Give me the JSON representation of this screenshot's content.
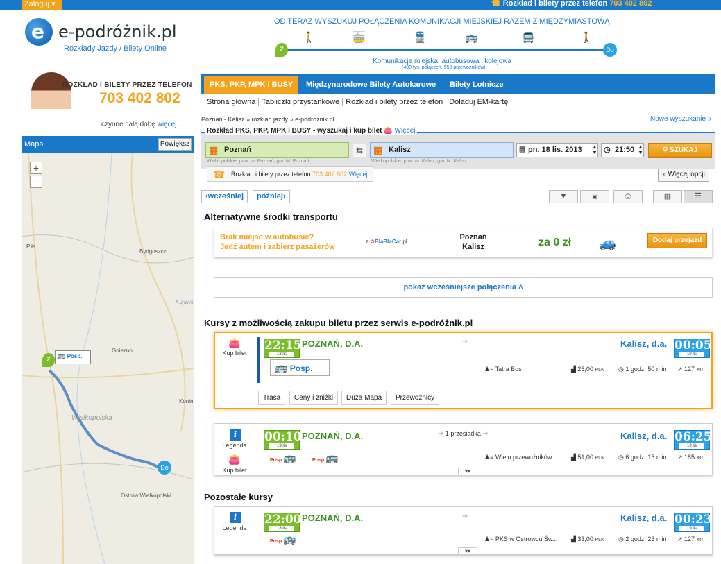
{
  "topbar": {
    "login": "Zaloguj",
    "phone_text": "Rozkład i bilety przez telefon",
    "phone_number": "703 402 802"
  },
  "logo": {
    "name": "e-podróżnik.pl",
    "subtitle": "Rozkłady Jazdy / Bilety Online"
  },
  "banner": {
    "title": "OD TERAZ WYSZUKUJ POŁĄCZENIA KOMUNIKACJI MIEJSKIEJ RAZEM Z MIĘDZYMIASTOWĄ",
    "z": "Z",
    "do": "Do",
    "sub1": "Komunikacja miejska, autobusowa i kolejowa",
    "sub2": "(400 tys. połączeń, 550 przewoźników)"
  },
  "phonebox": {
    "title": "ROZKŁAD I BILETY PRZEZ TELEFON",
    "number": "703 402 802",
    "hours": "czynne całą dobę",
    "more": "więcej..."
  },
  "map": {
    "title": "Mapa",
    "enlarge": "Powiększ",
    "zoom_in": "+",
    "zoom_out": "−",
    "labels": {
      "pila": "Piła",
      "bydgoszcz": "Bydgoszcz",
      "kujawy": "Kujaws",
      "gniezno": "Gniezno",
      "konin": "Konin",
      "wlkp": "Wielkopolska",
      "ostrow": "Ostrów Wielkopolski"
    },
    "marker_z": "Z",
    "marker_do": "Do",
    "posp": "Posp."
  },
  "tabs": [
    "PKS, PKP, MPK i BUSY",
    "Międzynarodowe Bilety Autokarowe",
    "Bilety Lotnicze"
  ],
  "subnav": [
    "Strona główna",
    "Tabliczki przystankowe",
    "Rozkład i bilety przez telefon",
    "Doładuj EM-kartę"
  ],
  "breadcrumb": "Poznań - Kalisz » rozkład jazdy » e-podroznik.pl",
  "new_search": "Nowe wyszukanie »",
  "search": {
    "legend": "Rozkład PKS, PKP, MPK i BUSY - wyszukaj i kup bilet",
    "legend_more": "Więcej",
    "from": "Poznań",
    "from_hint": "Wielkopolskie, pow. m. Poznań, gm. M. Poznań",
    "to": "Kalisz",
    "to_hint": "Wielkopolskie, pow. m. Kalisz, gm. M. Kalisz",
    "date": "pn. 18 lis. 2013",
    "time": "21:50",
    "button": "SZUKAJ",
    "more_options": "Więcej opcji",
    "phone_strip": "Rozkład i bilety przez telefon",
    "phone_number": "703 402 802",
    "phone_more": "Więcej"
  },
  "nav": {
    "earlier": "wcześniej",
    "later": "później"
  },
  "alt_transport": {
    "title": "Alternatywne środki transportu",
    "line1": "Brak miejsc w autobusie?",
    "line2": "Jedź autem i zabierz pasażerów",
    "logo_prefix": "z",
    "logo": "BlaBlaCar",
    "logo_suffix": ".pl",
    "route_from": "Poznań",
    "route_to": "Kalisz",
    "price": "za 0 zł",
    "button": "Dodaj przejazd"
  },
  "show_earlier": "pokaż wcześniejsze połączenia",
  "section_buy": "Kursy z możliwością zakupu biletu przez serwis e-podróżnik.pl",
  "section_other": "Pozostałe kursy",
  "routes": [
    {
      "buy_label": "Kup bilet",
      "dep_time": "22:15",
      "dep_date": "18 lis",
      "from": "POZNAŃ, D.A.",
      "posp": "Posp.",
      "to": "Kalisz, d.a.",
      "arr_time": "00:05",
      "arr_date": "19 lis",
      "carrier": "Tatra Bus",
      "price": "25,00",
      "currency": "PLN",
      "duration": "1 godz. 50 min",
      "distance": "127 km",
      "tabs": [
        "Trasa",
        "Ceny i zniżki",
        "Duża Mapa",
        "Przewoźnicy"
      ]
    },
    {
      "legend": "Legenda",
      "buy_label": "Kup bilet",
      "dep_time": "00:10",
      "dep_date": "19 lis",
      "from": "POZNAŃ, D.A.",
      "transfer": "1 przesiadka",
      "posp": "Posp.",
      "to": "Kalisz, d.a.",
      "arr_time": "06:25",
      "arr_date": "19 lis",
      "carrier": "Wielu przewoźników",
      "price": "51,00",
      "currency": "PLN",
      "duration": "6 godz. 15 min",
      "distance": "185 km"
    },
    {
      "legend": "Legenda",
      "dep_time": "22:00",
      "dep_date": "18 lis",
      "from": "POZNAŃ, D.A.",
      "posp": "Posp.",
      "to": "Kalisz, d.a.",
      "arr_time": "00:23",
      "arr_date": "19 lis",
      "carrier": "PKS w Ostrowcu Św...",
      "price": "33,00",
      "currency": "PLN",
      "duration": "2 godz. 23 min",
      "distance": "127 km"
    }
  ],
  "colors": {
    "brand_blue": "#1a78c8",
    "orange": "#f3a21a",
    "green": "#7bbd2a",
    "red": "#d9261c"
  }
}
